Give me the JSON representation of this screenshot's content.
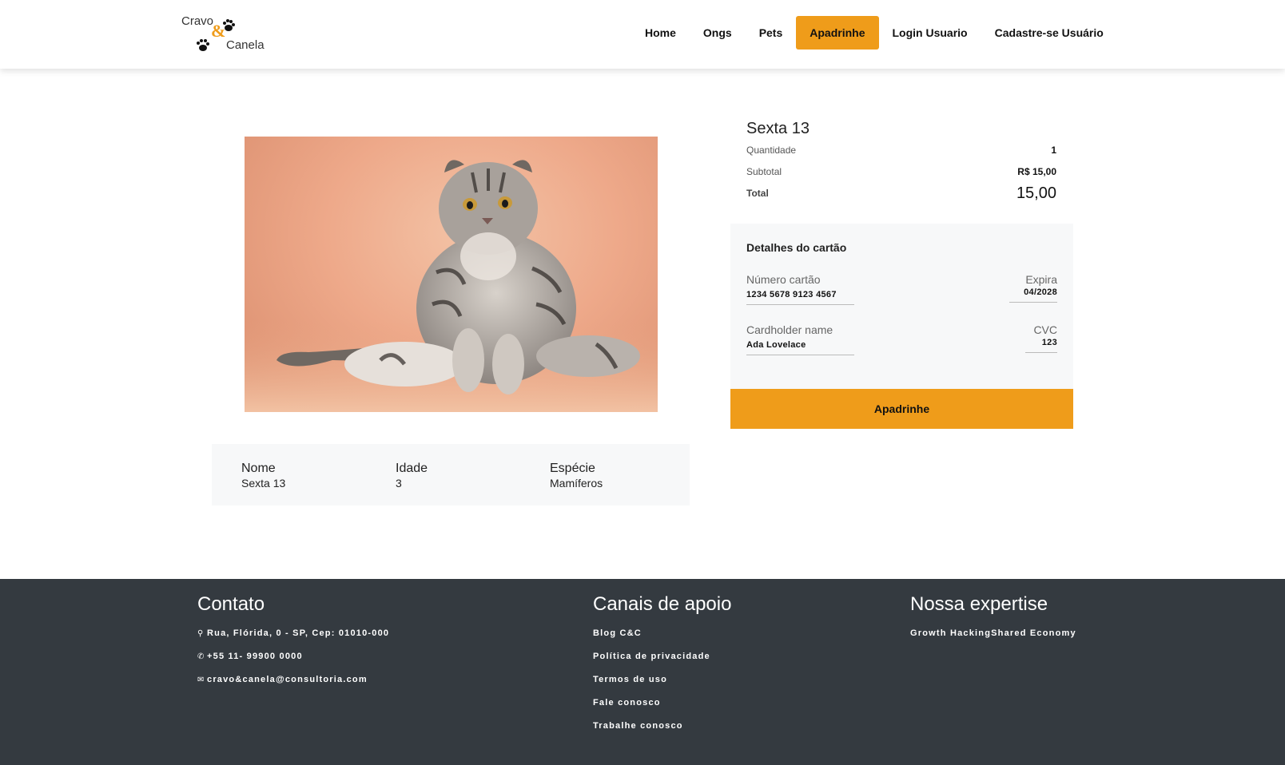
{
  "brand": {
    "name_top": "Cravo",
    "name_bottom": "Canela",
    "accent_color": "#ef9c1a",
    "logo_icon": "paw-prints-icon"
  },
  "nav": {
    "items": [
      {
        "label": "Home",
        "active": false
      },
      {
        "label": "Ongs",
        "active": false
      },
      {
        "label": "Pets",
        "active": false
      },
      {
        "label": "Apadrinhe",
        "active": true
      },
      {
        "label": "Login Usuario",
        "active": false
      },
      {
        "label": "Cadastre-se Usuário",
        "active": false
      }
    ]
  },
  "pet": {
    "image": "tabby-cat-photo",
    "info": [
      {
        "label": "Nome",
        "value": "Sexta 13"
      },
      {
        "label": "Idade",
        "value": "3"
      },
      {
        "label": "Espécie",
        "value": "Mamíferos"
      }
    ]
  },
  "summary": {
    "title": "Sexta 13",
    "quantity_label": "Quantidade",
    "quantity_value": "1",
    "subtotal_label": "Subtotal",
    "subtotal_value": "R$ 15,00",
    "total_label": "Total",
    "total_value": "15,00"
  },
  "card": {
    "title": "Detalhes do cartão",
    "number_label": "Número cartão",
    "number_value": "1234 5678 9123 4567",
    "expiry_label": "Expira",
    "expiry_value": "04/2028",
    "holder_label": "Cardholder name",
    "holder_value": "Ada Lovelace",
    "cvc_label": "CVC",
    "cvc_value": "123",
    "button_label": "Apadrinhe"
  },
  "footer": {
    "background": "#343a40",
    "contato": {
      "title": "Contato",
      "address": "Rua, Flórida, 0 - SP, Cep: 01010-000",
      "phone": "+55 11- 99900 0000",
      "email": "cravo&canela@consultoria.com"
    },
    "apoio": {
      "title": "Canais de apoio",
      "links": [
        "Blog C&C",
        "Política de privacidade",
        "Termos de uso",
        "Fale conosco",
        "Trabalhe conosco"
      ]
    },
    "expertise": {
      "title": "Nossa expertise",
      "items": "Growth HackingShared Economy"
    }
  }
}
